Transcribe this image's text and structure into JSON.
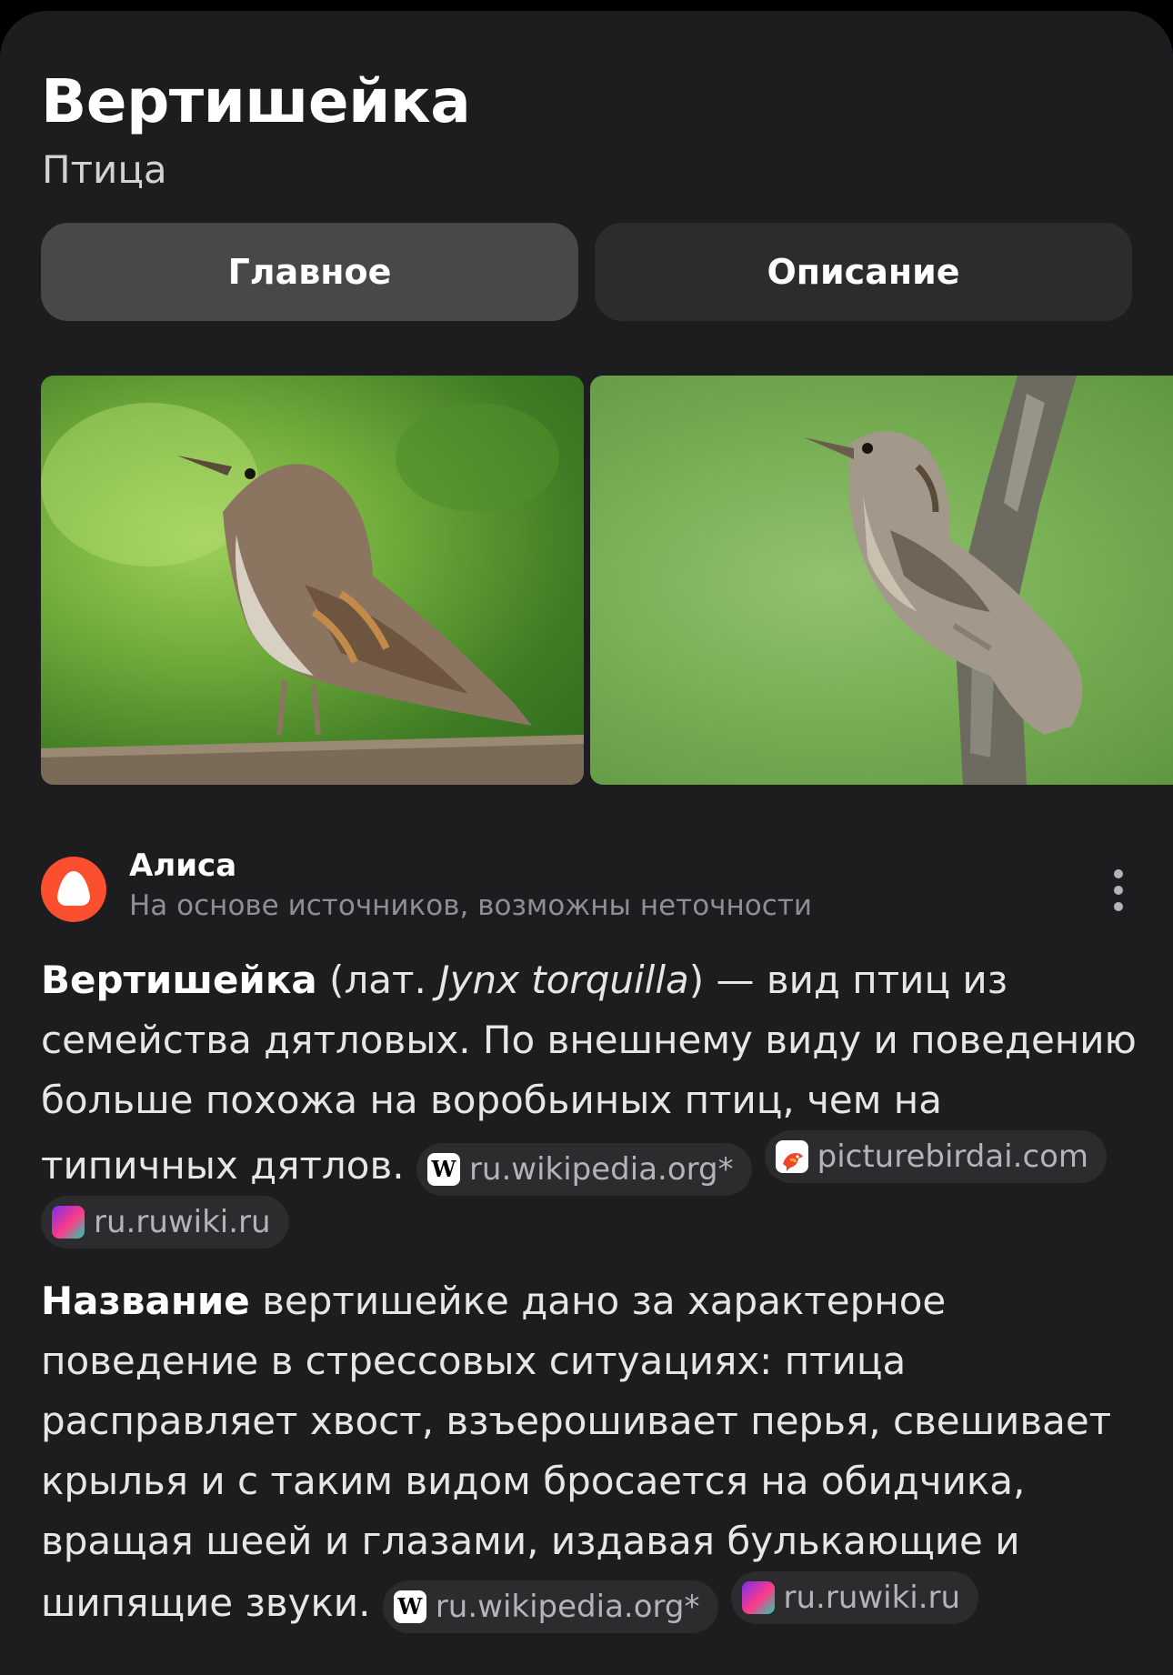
{
  "header": {
    "title": "Вертишейка",
    "subtitle": "Птица"
  },
  "tabs": [
    {
      "label": "Главное",
      "active": true
    },
    {
      "label": "Описание",
      "active": false
    }
  ],
  "alice": {
    "name": "Алиса",
    "note": "На основе источников, возможны неточности"
  },
  "paragraph1": {
    "bold": "Вертишейка",
    "pre_latin": " (лат. ",
    "latin": "Jynx torquilla",
    "rest": ") — вид птиц из семейства дятловых. По внешнему виду и поведению больше похожа на воробьиных птиц, чем на типичных дятлов.",
    "sources": [
      {
        "label": "ru.wikipedia.org*",
        "icon": "wikipedia-icon"
      },
      {
        "label": "picturebirdai.com",
        "icon": "bird-icon"
      },
      {
        "label": "ru.ruwiki.ru",
        "icon": "ruwiki-icon"
      }
    ]
  },
  "paragraph2": {
    "bold": "Название",
    "rest": " вертишейке дано за характерное поведение в стрессовых ситуациях: птица расправляет хвост, взъерошивает перья, свешивает крылья и с таким видом бросается на обидчика, вращая шеей и глазами, издавая булькающие и шипящие звуки.",
    "sources": [
      {
        "label": "ru.wikipedia.org*",
        "icon": "wikipedia-icon"
      },
      {
        "label": "ru.ruwiki.ru",
        "icon": "ruwiki-icon"
      }
    ]
  },
  "colors": {
    "background": "#1d1d1f",
    "tab_active": "#48484a",
    "tab_inactive": "#2c2c2e",
    "alice_brand": "#fb4f2f"
  }
}
